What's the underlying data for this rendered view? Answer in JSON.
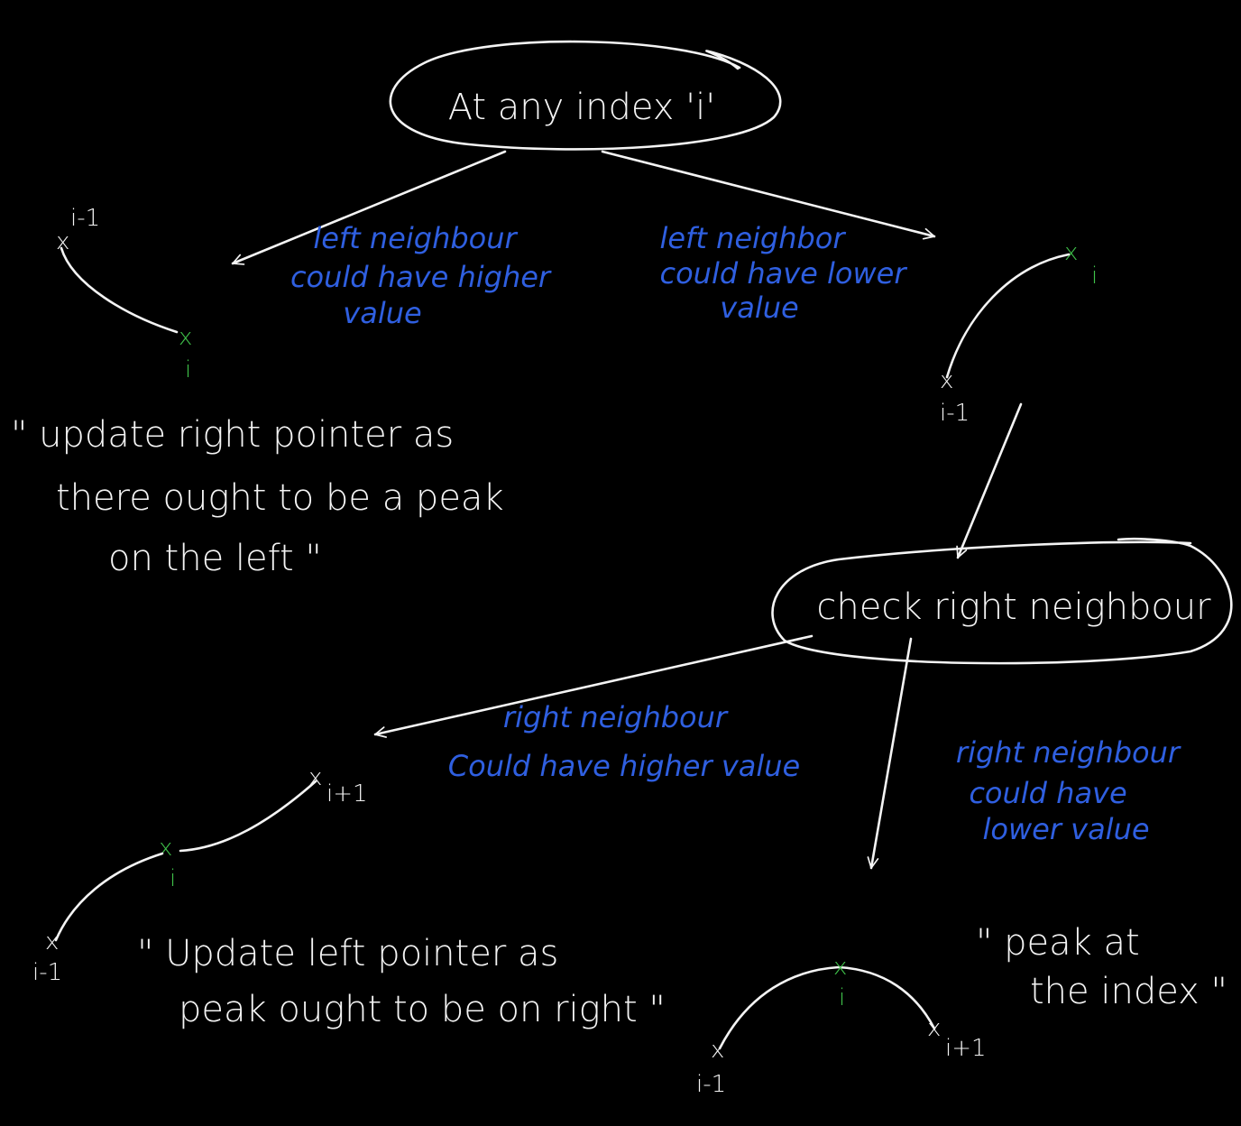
{
  "colors": {
    "background": "#000000",
    "ink": "#f4f4f4",
    "annotation": "#2f5fe0",
    "marker": "#3fc24a"
  },
  "nodes": {
    "root": "At any index 'i'",
    "check": "check right neighbour"
  },
  "edges": {
    "left_higher": [
      "left neighbour",
      "could have higher",
      "value"
    ],
    "left_lower": [
      "left neighbor",
      "could have lower",
      "value"
    ],
    "right_higher": [
      "right neighbour",
      "Could have higher value"
    ],
    "right_lower": [
      "right neighbour",
      "could have",
      "lower value"
    ]
  },
  "outcomes": {
    "update_right": [
      "\" update right pointer as",
      "there ought to be a peak",
      "on the left \""
    ],
    "update_left": [
      "\" Update left pointer as",
      "peak ought to be on right \""
    ],
    "peak": [
      "\" peak at",
      "the index \""
    ]
  },
  "labels": {
    "i": "i",
    "i_minus_1": "i-1",
    "i_plus_1": "i+1",
    "x_mark": "x"
  }
}
